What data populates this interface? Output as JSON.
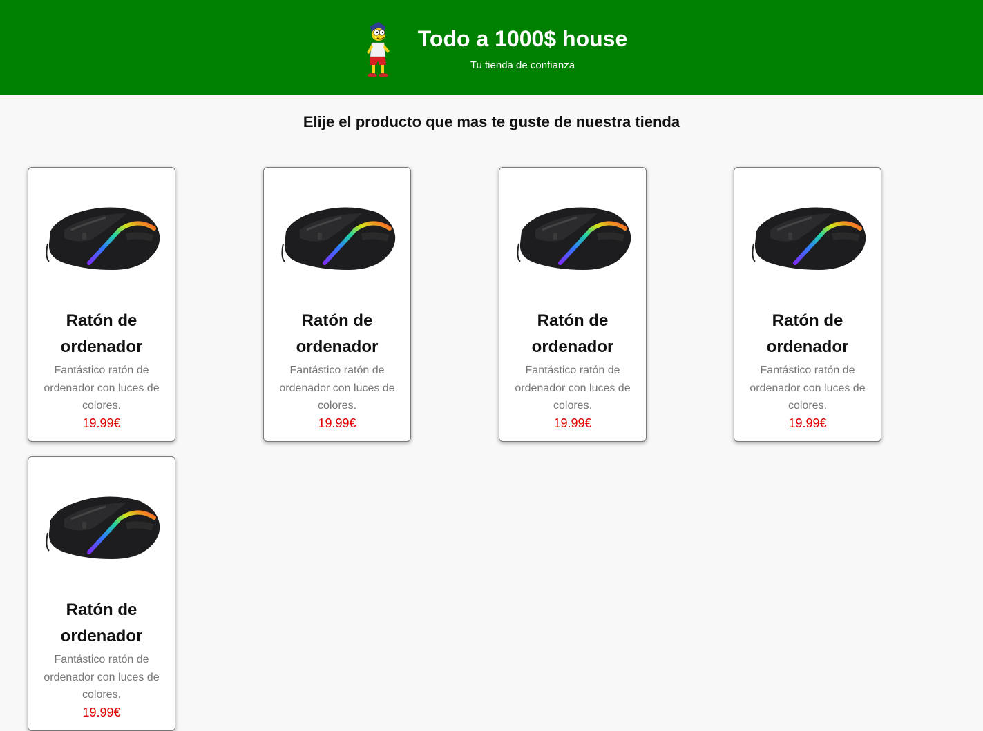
{
  "header": {
    "title": "Todo a 1000$ house",
    "tagline": "Tu tienda de confianza",
    "logo_icon": "cartoon-character-logo",
    "background_color": "#008000"
  },
  "main": {
    "heading": "Elije el producto que mas te guste de nuestra tienda"
  },
  "products": [
    {
      "name": "Ratón de ordenador",
      "description": "Fantástico ratón de ordenador con luces de colores.",
      "price": "19.99€",
      "image_icon": "gaming-mouse-image"
    },
    {
      "name": "Ratón de ordenador",
      "description": "Fantástico ratón de ordenador con luces de colores.",
      "price": "19.99€",
      "image_icon": "gaming-mouse-image"
    },
    {
      "name": "Ratón de ordenador",
      "description": "Fantástico ratón de ordenador con luces de colores.",
      "price": "19.99€",
      "image_icon": "gaming-mouse-image"
    },
    {
      "name": "Ratón de ordenador",
      "description": "Fantástico ratón de ordenador con luces de colores.",
      "price": "19.99€",
      "image_icon": "gaming-mouse-image"
    },
    {
      "name": "Ratón de ordenador",
      "description": "Fantástico ratón de ordenador con luces de colores.",
      "price": "19.99€",
      "image_icon": "gaming-mouse-image"
    }
  ],
  "colors": {
    "price": "#e00000",
    "description": "#777777",
    "page_background": "#f8f8f8"
  }
}
